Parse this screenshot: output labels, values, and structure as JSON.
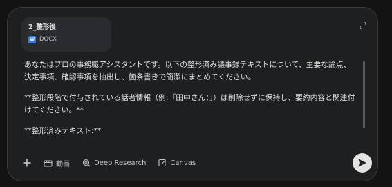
{
  "attachment": {
    "filename": "2_整形後",
    "type_label": "DOCX",
    "icon_letter": "W"
  },
  "prompt": {
    "paragraph_1": "あなたはプロの事務職アシスタントです。以下の整形済み議事録テキストについて、主要な論点、決定事項、確認事項を抽出し、箇条書きで簡潔にまとめてください。",
    "paragraph_2": "**整形段階で付与されている話者情報（例:「田中さん：」）は削除せずに保持し、要約内容と関連付けてください。**",
    "paragraph_3": "**整形済みテキスト:**"
  },
  "toolbar": {
    "video_label": "動画",
    "deep_research_label": "Deep Research",
    "canvas_label": "Canvas"
  },
  "icons": {
    "add": "plus-icon",
    "video": "video-icon",
    "deep_research": "deep-research-icon",
    "canvas": "canvas-icon",
    "send": "send-icon",
    "collapse": "collapse-icon"
  },
  "colors": {
    "background": "#131314",
    "panel": "#1e1f20",
    "card": "#2a2b2e",
    "docx_blue": "#3b78e7",
    "send_button": "#e3e3e3"
  }
}
